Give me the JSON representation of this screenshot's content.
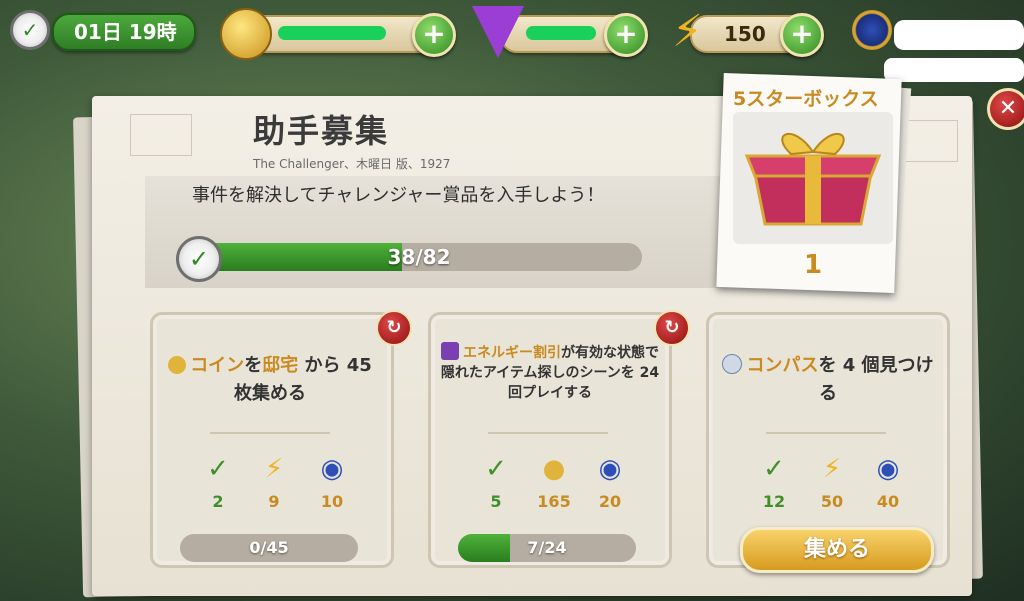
{
  "topbar": {
    "timer": "01日 19時",
    "energy_value": "150",
    "plus_symbol": "+"
  },
  "colors": {
    "accent_gold": "#c98a20",
    "progress_green": "#2f8a22",
    "redaction_green": "#18d05a",
    "close_red": "#c92a2a"
  },
  "main": {
    "title": "助手募集",
    "subtitle": "The Challenger、木曜日 版、1927",
    "goal_text": "事件を解決してチャレンジャー賞品を入手しよう！",
    "progress_label": "38/82",
    "progress_fraction": 0.463
  },
  "star_box": {
    "title": "5スターボックス",
    "count": "1"
  },
  "tasks": [
    {
      "title_parts": [
        "コイン",
        "を",
        "邸宅",
        "から 45 枚集める"
      ],
      "rewards": [
        {
          "icon": "check-icon",
          "value": "2"
        },
        {
          "icon": "energy-icon",
          "value": "9"
        },
        {
          "icon": "magnifier-medal-icon",
          "value": "10"
        }
      ],
      "progress_label": "0/45",
      "progress_fraction": 0
    },
    {
      "title_parts": [
        "エネルギー割引",
        "が有効な状態で隠れたアイテム探しのシーンを 24 回プレイする"
      ],
      "rewards": [
        {
          "icon": "check-icon",
          "value": "5"
        },
        {
          "icon": "coin-icon",
          "value": "165"
        },
        {
          "icon": "magnifier-medal-icon",
          "value": "20"
        }
      ],
      "progress_label": "7/24",
      "progress_fraction": 0.292
    },
    {
      "title_parts": [
        "コンパス",
        "を 4 個見つける"
      ],
      "rewards": [
        {
          "icon": "check-icon",
          "value": "12"
        },
        {
          "icon": "energy-icon",
          "value": "50"
        },
        {
          "icon": "magnifier-medal-icon",
          "value": "40"
        }
      ],
      "button_label": "集める"
    }
  ]
}
